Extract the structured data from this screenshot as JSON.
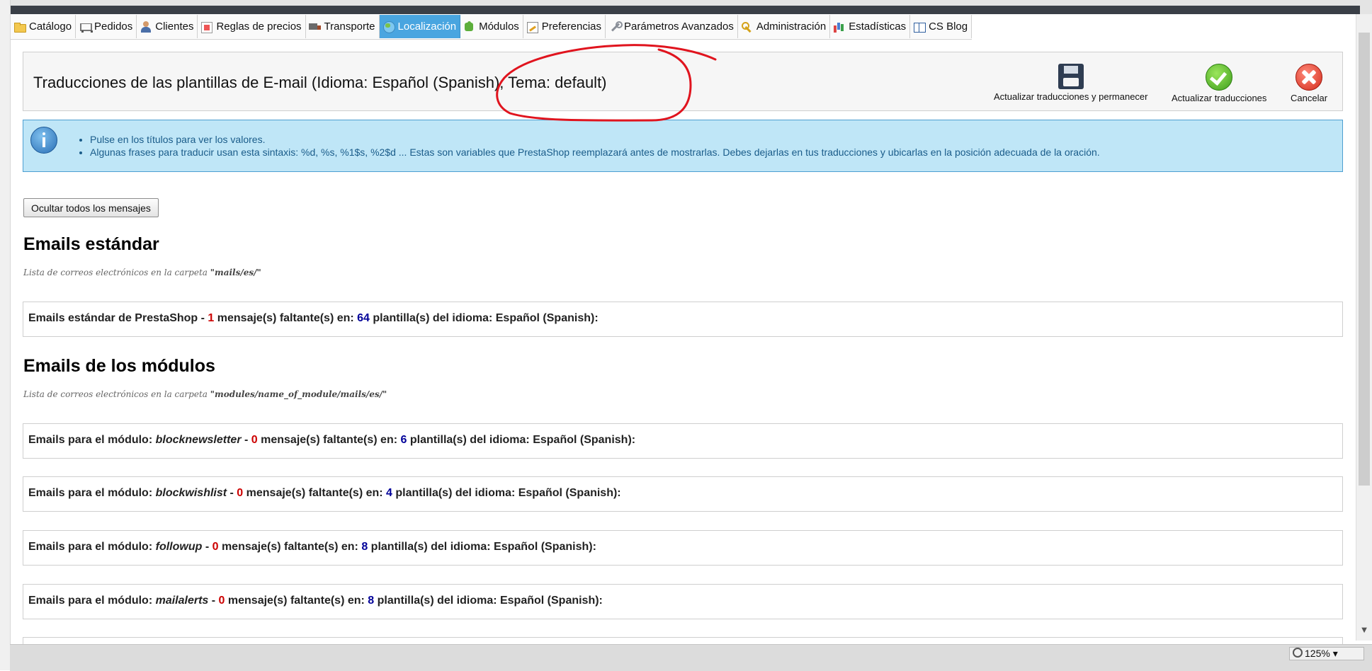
{
  "nav": {
    "tabs": [
      {
        "label": "Catálogo",
        "icon": "folder-icon",
        "name": "tab-catalogo"
      },
      {
        "label": "Pedidos",
        "icon": "cart-icon",
        "name": "tab-pedidos"
      },
      {
        "label": "Clientes",
        "icon": "user-icon",
        "name": "tab-clientes"
      },
      {
        "label": "Reglas de precios",
        "icon": "price-rules-icon",
        "name": "tab-reglas-de-precios"
      },
      {
        "label": "Transporte",
        "icon": "truck-icon",
        "name": "tab-transporte"
      },
      {
        "label": "Localización",
        "icon": "globe-icon",
        "name": "tab-localizacion",
        "active": true
      },
      {
        "label": "Módulos",
        "icon": "puzzle-icon",
        "name": "tab-modulos"
      },
      {
        "label": "Preferencias",
        "icon": "preferences-icon",
        "name": "tab-preferencias"
      },
      {
        "label": "Parámetros Avanzados",
        "icon": "wrench-icon",
        "name": "tab-parametros-avanzados"
      },
      {
        "label": "Administración",
        "icon": "key-icon",
        "name": "tab-administracion"
      },
      {
        "label": "Estadísticas",
        "icon": "stats-icon",
        "name": "tab-estadisticas"
      },
      {
        "label": "CS Blog",
        "icon": "book-icon",
        "name": "tab-cs-blog"
      }
    ],
    "active_color": "#49a5e0"
  },
  "toolbar": {
    "title": "Traducciones de las plantillas de E-mail (Idioma: Español (Spanish), Tema: default)",
    "save_stay_label": "Actualizar traducciones y permanecer",
    "save_label": "Actualizar traducciones",
    "cancel_label": "Cancelar"
  },
  "info": {
    "items": [
      "Pulse en los títulos para ver los valores.",
      "Algunas frases para traducir usan esta sintaxis: %d, %s, %1$s, %2$d ... Estas son variables que PrestaShop reemplazará antes de mostrarlas. Debes dejarlas en tus traducciones y ubicarlas en la posición adecuada de la oración."
    ]
  },
  "hide_button_label": "Ocultar todos los mensajes",
  "standard": {
    "heading": "Emails estándar",
    "caption_prefix": "Lista de correos electrónicos en la carpeta ",
    "caption_path": "\"mails/es/\"",
    "row": {
      "prefix": "Emails estándar de PrestaShop - ",
      "missing": "1",
      "middle": " mensaje(s) faltante(s) en: ",
      "total": "64",
      "suffix": " plantilla(s) del idioma: Español (Spanish):"
    }
  },
  "modules": {
    "heading": "Emails de los módulos",
    "caption_prefix": "Lista de correos electrónicos en la carpeta ",
    "caption_path": "\"modules/name_of_module/mails/es/\"",
    "row_prefix": "Emails para el módulo: ",
    "row_middle": " mensaje(s) faltante(s) en: ",
    "row_suffix": " plantilla(s) del idioma: Español (Spanish):",
    "rows": [
      {
        "module": "blocknewsletter",
        "missing": "0",
        "total": "6"
      },
      {
        "module": "blockwishlist",
        "missing": "0",
        "total": "4"
      },
      {
        "module": "followup",
        "missing": "0",
        "total": "8"
      },
      {
        "module": "mailalerts",
        "missing": "0",
        "total": "8"
      }
    ]
  },
  "statusbar": {
    "zoom": "125%"
  },
  "colors": {
    "missing": "#cc0000",
    "total": "#000099",
    "annotation": "#e0141e",
    "info_bg": "#bfe6f7"
  }
}
